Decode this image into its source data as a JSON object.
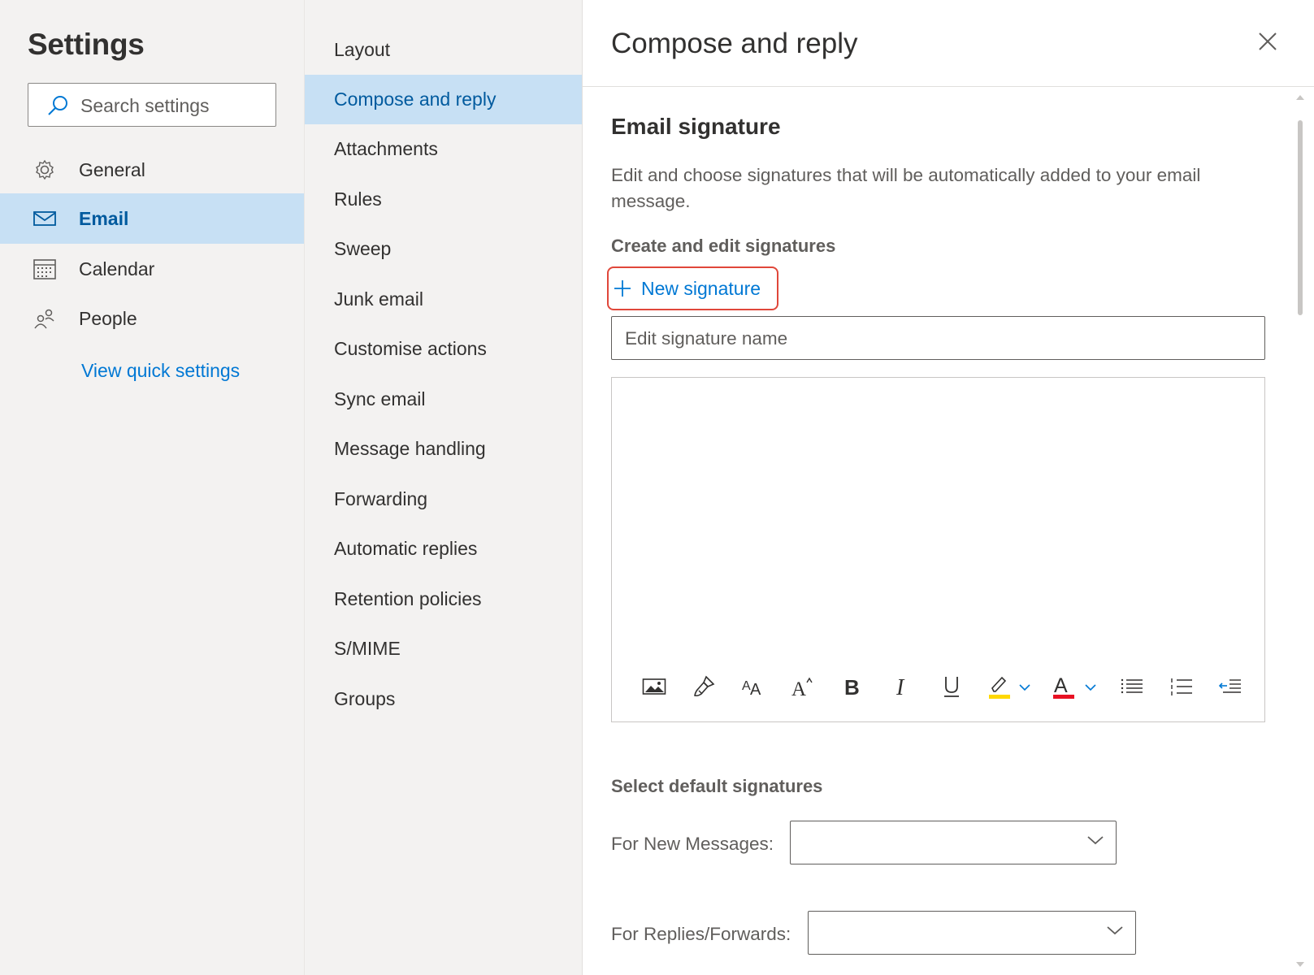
{
  "settings": {
    "title": "Settings",
    "search_placeholder": "Search settings"
  },
  "nav": {
    "items": [
      {
        "label": "General",
        "icon": "gear-icon"
      },
      {
        "label": "Email",
        "icon": "mail-icon",
        "active": true
      },
      {
        "label": "Calendar",
        "icon": "calendar-icon"
      },
      {
        "label": "People",
        "icon": "people-icon"
      }
    ],
    "quick_settings": "View quick settings"
  },
  "subnav": {
    "items": [
      "Layout",
      "Compose and reply",
      "Attachments",
      "Rules",
      "Sweep",
      "Junk email",
      "Customise actions",
      "Sync email",
      "Message handling",
      "Forwarding",
      "Automatic replies",
      "Retention policies",
      "S/MIME",
      "Groups"
    ],
    "active": "Compose and reply"
  },
  "pane": {
    "title": "Compose and reply",
    "email_signature_heading": "Email signature",
    "description": "Edit and choose signatures that will be automatically added to your email message.",
    "create_heading": "Create and edit signatures",
    "new_signature": "New signature",
    "signature_name_placeholder": "Edit signature name",
    "toolbar": [
      "insert-picture-icon",
      "format-painter-icon",
      "font-size-icon",
      "superscript-icon",
      "bold-icon",
      "italic-icon",
      "underline-icon",
      "highlight-icon",
      "font-color-icon",
      "bullets-icon",
      "numbering-icon",
      "decrease-indent-icon"
    ],
    "default_heading": "Select default signatures",
    "for_new_messages": "For New Messages:",
    "for_replies": "For Replies/Forwards:",
    "for_new_messages_value": "",
    "for_replies_value": ""
  },
  "colors": {
    "accent": "#0078d4",
    "active_bg": "#c7e0f4",
    "highlight_box": "#e0473a",
    "highlight_yellow": "#ffd800",
    "font_red": "#e81123"
  }
}
